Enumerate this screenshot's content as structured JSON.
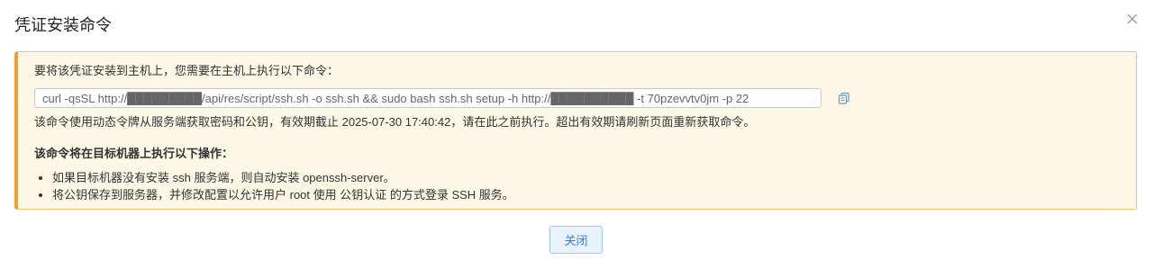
{
  "dialog": {
    "title": "凭证安装命令",
    "close_icon": "close-icon"
  },
  "panel": {
    "intro": "要将该凭证安装到主机上，您需要在主机上执行以下命令：",
    "command": "curl -qsSL http://█████████/api/res/script/ssh.sh -o ssh.sh && sudo bash ssh.sh setup -h http://██████████ -t 70pzevvtv0jm -p 22",
    "copy_icon": "copy-icon",
    "note": "该命令使用动态令牌从服务端获取密码和公钥，有效期截止 2025-07-30 17:40:42，请在此之前执行。超出有效期请刷新页面重新获取命令。",
    "ops_title": "该命令将在目标机器上执行以下操作：",
    "ops": [
      "如果目标机器没有安装 ssh 服务端，则自动安装 openssh-server。",
      "将公钥保存到服务器，并修改配置以允许用户 root 使用 公钥认证 的方式登录 SSH 服务。"
    ]
  },
  "footer": {
    "close_label": "关闭"
  },
  "colors": {
    "panel_bg": "#fdf7e6",
    "panel_accent": "#f0a030",
    "button_text": "#2b7fd6",
    "button_bg": "#e8f3ff"
  }
}
